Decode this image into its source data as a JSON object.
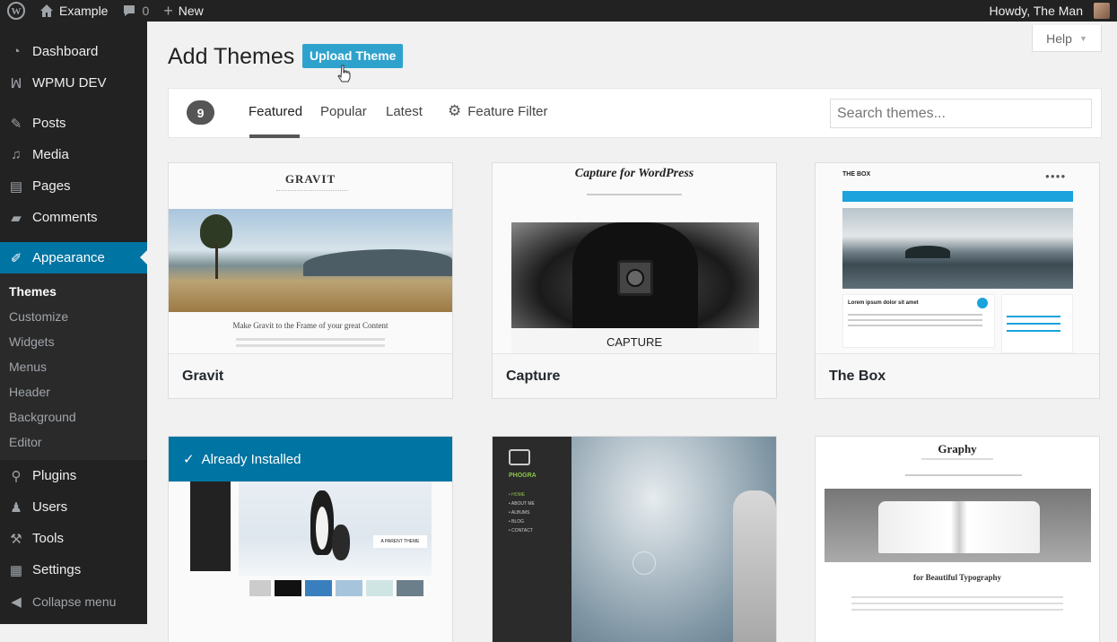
{
  "adminbar": {
    "site_name": "Example",
    "comments_count": "0",
    "new_label": "New",
    "howdy": "Howdy, The Man"
  },
  "sidebar": {
    "items": [
      {
        "label": "Dashboard",
        "icon": "dashboard-icon"
      },
      {
        "label": "WPMU DEV",
        "icon": "wpmudev-icon"
      },
      {
        "label": "Posts",
        "icon": "pin-icon"
      },
      {
        "label": "Media",
        "icon": "media-icon"
      },
      {
        "label": "Pages",
        "icon": "pages-icon"
      },
      {
        "label": "Comments",
        "icon": "comment-icon"
      },
      {
        "label": "Appearance",
        "icon": "brush-icon"
      },
      {
        "label": "Plugins",
        "icon": "plugin-icon"
      },
      {
        "label": "Users",
        "icon": "users-icon"
      },
      {
        "label": "Tools",
        "icon": "wrench-icon"
      },
      {
        "label": "Settings",
        "icon": "settings-icon"
      }
    ],
    "submenu": [
      "Themes",
      "Customize",
      "Widgets",
      "Menus",
      "Header",
      "Background",
      "Editor"
    ],
    "collapse": "Collapse menu"
  },
  "main": {
    "title": "Add Themes",
    "upload_button": "Upload Theme",
    "help": "Help",
    "count": "9",
    "tabs": [
      "Featured",
      "Popular",
      "Latest",
      "Feature Filter"
    ],
    "search_placeholder": "Search themes..."
  },
  "themes": [
    {
      "name": "Gravit",
      "logo": "GRAVIT",
      "tagline": "Make Gravit to the Frame of your great Content"
    },
    {
      "name": "Capture",
      "logo": "Capture for WordPress",
      "tagline": "CAPTURE"
    },
    {
      "name": "The Box",
      "logo": "THE BOX",
      "tagline": "Lorem ipsum dolor sit amet"
    },
    {
      "name": "",
      "installed": "Already Installed",
      "tagline": "A PARENT THEME"
    },
    {
      "name": "",
      "logo": "PHOGRA",
      "menu": [
        "• HOME",
        "• ABOUT ME",
        "• ALBUMS",
        "• BLOG",
        "• CONTACT"
      ]
    },
    {
      "name": "",
      "logo": "Graphy",
      "tagline": "for Beautiful Typography"
    }
  ],
  "colors": {
    "accent": "#0074a2",
    "button": "#2ea2cc",
    "sidebar": "#222222"
  }
}
